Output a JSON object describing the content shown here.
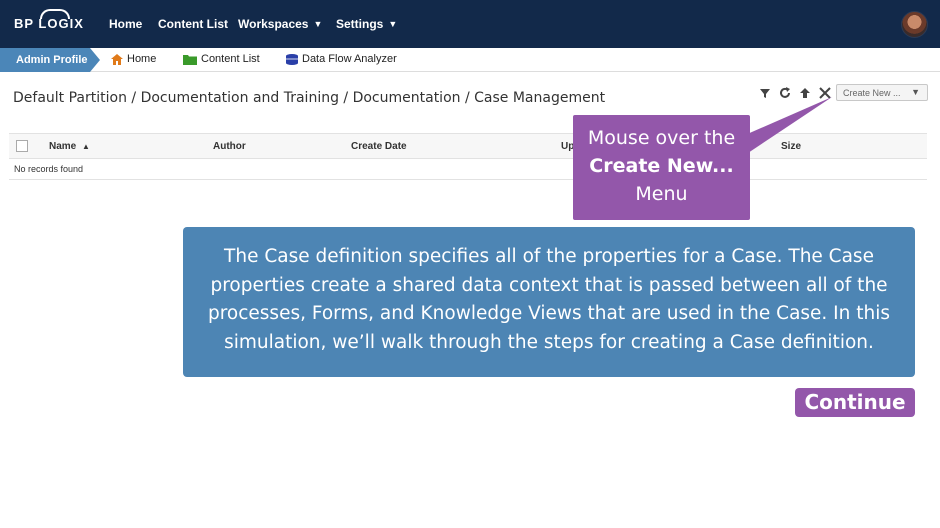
{
  "topbar": {
    "logo_text": "BP LOGIX",
    "nav": [
      {
        "label": "Home"
      },
      {
        "label": "Content List"
      },
      {
        "label": "Workspaces",
        "icon": "chevron-down-icon"
      },
      {
        "label": "Settings",
        "icon": "chevron-down-icon"
      }
    ],
    "avatar": "user-avatar"
  },
  "subbar": {
    "admin_label": "Admin Profile",
    "crumbs": [
      {
        "label": "Home",
        "icon": "home-icon",
        "color": "#e07a1a"
      },
      {
        "label": "Content List",
        "icon": "folder-icon",
        "color": "#3a9a2a"
      },
      {
        "label": "Data Flow Analyzer",
        "icon": "database-icon",
        "color": "#2a3fa8"
      }
    ]
  },
  "path": {
    "text": "Default Partition / Documentation and Training / Documentation / Case Management"
  },
  "toolbar": {
    "icons": [
      "filter-icon",
      "refresh-icon",
      "up-arrow-icon",
      "tools-icon"
    ],
    "create_label": "Create New ...",
    "create_icon": "chevron-down-icon"
  },
  "table": {
    "columns": [
      "Name",
      "Author",
      "Create Date",
      "Up",
      "Size"
    ],
    "sort_indicator": "▲",
    "empty_text": "No records found"
  },
  "tooltip": {
    "line1": "Mouse over the",
    "line2": "Create New...",
    "line3": "Menu"
  },
  "info": {
    "text": "The Case definition specifies all of the properties for a Case. The Case properties create a shared data context that is passed between all of the processes, Forms, and Knowledge Views that are used in the Case. In this simulation, we’ll walk through the steps for creating a Case definition."
  },
  "continue_label": "Continue",
  "colors": {
    "topbar": "#12294a",
    "admin_tab": "#4b86b8",
    "callout_purple": "#9357aa",
    "info_blue": "#4d85b4"
  }
}
